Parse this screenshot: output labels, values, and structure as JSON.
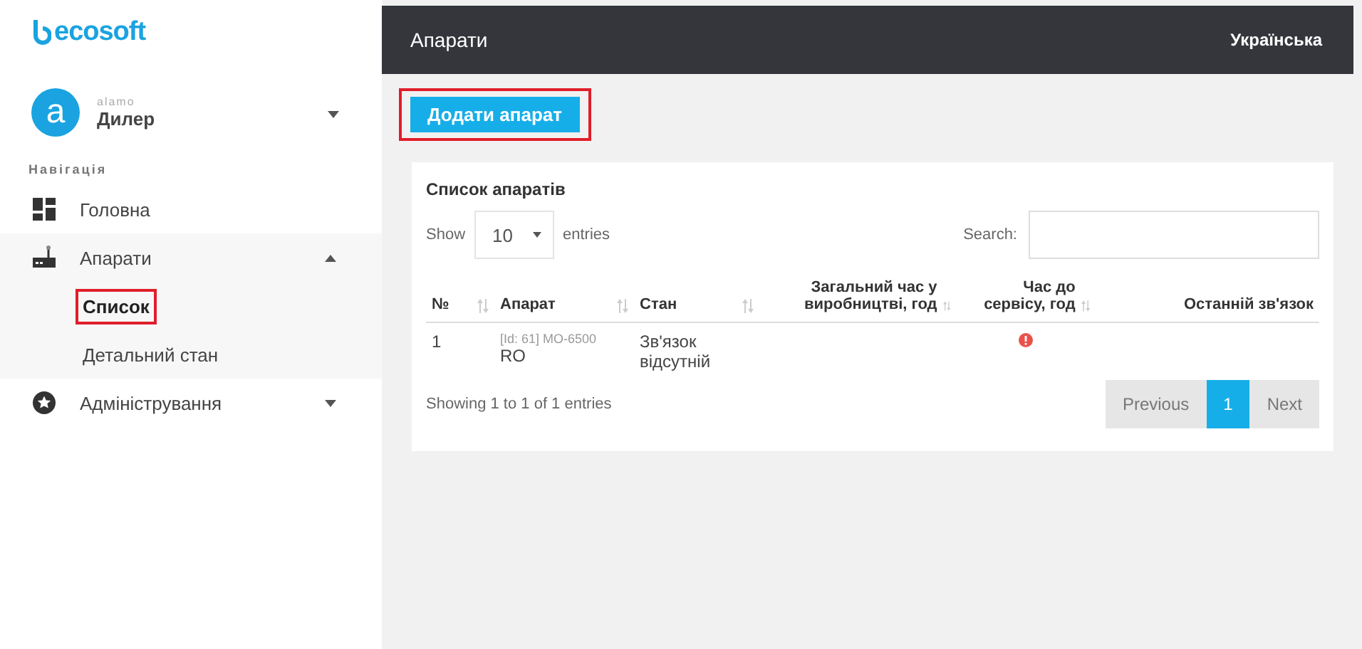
{
  "sidebar": {
    "logo": "ecosoft",
    "user": {
      "avatar_letter": "a",
      "login": "alamo",
      "role": "Дилер"
    },
    "section_title": "Навігація",
    "items": [
      {
        "label": "Головна",
        "selected": false
      },
      {
        "label": "Апарати",
        "expanded": true,
        "selected": false,
        "children": [
          {
            "label": "Список",
            "selected": true,
            "highlighted": true
          },
          {
            "label": "Детальний стан",
            "selected": false,
            "highlighted": false
          }
        ]
      },
      {
        "label": "Адміністрування",
        "expanded": false,
        "selected": false
      }
    ]
  },
  "header": {
    "title": "Апарати",
    "language": "Українська"
  },
  "add_button": {
    "label": "Додати апарат",
    "highlighted": true
  },
  "card": {
    "title": "Список апаратів",
    "length_prefix": "Show",
    "length_value": "10",
    "length_suffix": "entries",
    "search_label": "Search:",
    "columns": [
      {
        "label": "№",
        "sortable": true
      },
      {
        "label": "Апарат",
        "sortable": true
      },
      {
        "label": "Стан",
        "sortable": true
      },
      {
        "label": "Загальний час у виробництві, год",
        "sortable": true
      },
      {
        "label": "Час до сервісу, год",
        "sortable": true
      },
      {
        "label": "Останній зв'язок",
        "sortable": false
      }
    ],
    "rows": [
      {
        "number": "1",
        "device_id": "[Id: 61] MO-6500",
        "device_name": "RO",
        "status": "Зв'язок відсутній",
        "service_alert": true
      }
    ],
    "info": "Showing 1 to 1 of 1 entries",
    "pagination": [
      {
        "label": "Previous",
        "selected": false
      },
      {
        "label": "1",
        "selected": true
      },
      {
        "label": "Next",
        "selected": false
      }
    ]
  }
}
